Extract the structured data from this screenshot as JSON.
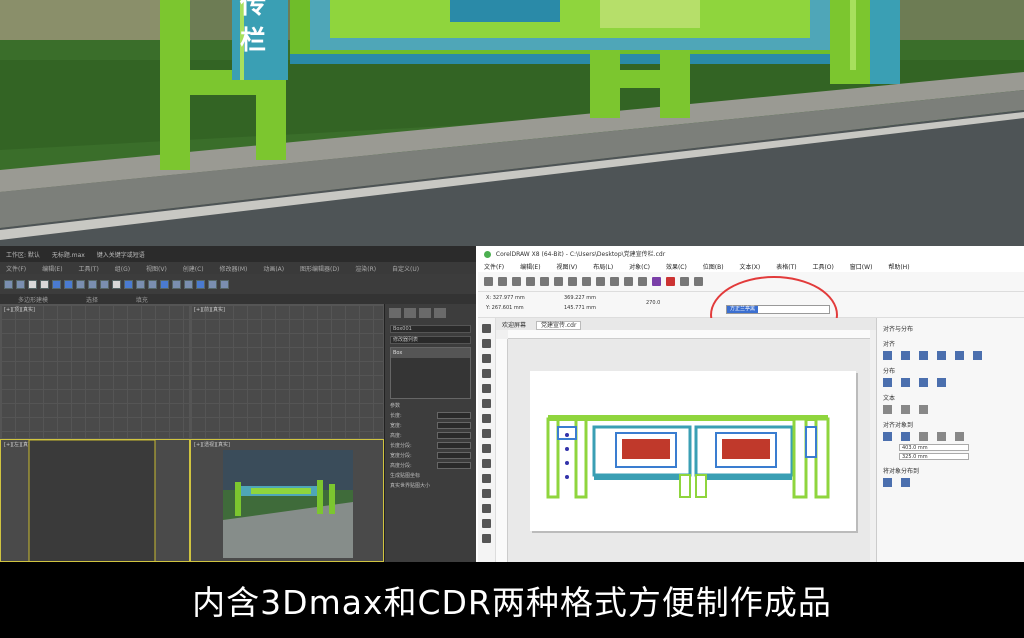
{
  "scene": {
    "left_sign_text": "栏",
    "left_sign_top_text": "传"
  },
  "max": {
    "title_items": [
      "工作区: 默认",
      "无标题.max",
      "键入关键字或短语"
    ],
    "menu_items": [
      "文件(F)",
      "编辑(E)",
      "工具(T)",
      "组(G)",
      "视图(V)",
      "创建(C)",
      "修改器(M)",
      "动画(A)",
      "图形编辑器(D)",
      "渲染(R)",
      "自定义(U)",
      "脚本(S)",
      "帮助(H)"
    ],
    "ribbon_items": [
      "多边形建模",
      "选择",
      "填充"
    ],
    "viewports": {
      "top": "[+][顶][真实]",
      "front": "[+][前][真实]",
      "left": "[+][左][真实]",
      "persp": "[+][透视][真实]"
    },
    "cmd": {
      "object_name": "Box001",
      "modifier": "修改器列表",
      "stack_item": "Box",
      "rollout": "参数",
      "params": [
        "长度:",
        "宽度:",
        "高度:",
        "长度分段:",
        "宽度分段:",
        "高度分段:"
      ],
      "checks": [
        "生成贴图坐标",
        "真实世界贴图大小"
      ]
    }
  },
  "cdr": {
    "title": "CorelDRAW X8 (64-Bit) - C:\\Users\\Desktop\\党建宣传栏.cdr",
    "menu_items": [
      "文件(F)",
      "编辑(E)",
      "视图(V)",
      "布局(L)",
      "对象(C)",
      "效果(C)",
      "位图(B)",
      "文本(X)",
      "表格(T)",
      "工具(O)",
      "窗口(W)",
      "帮助(H)"
    ],
    "prop_x": "X: 327.977 mm",
    "prop_y": "Y: 267.601 mm",
    "prop_w": "369.227 mm",
    "prop_h": "145.771 mm",
    "angle": "270.0",
    "font_value": "方正兰亭黑",
    "tabs": [
      "欢迎屏幕",
      "党建宣传.cdr"
    ],
    "dock": {
      "align_title": "对齐与分布",
      "align": "对齐",
      "distribute": "分布",
      "text": "文本",
      "align_objects": "对齐对象到",
      "field1": "403.0 mm",
      "field2": "325.0 mm",
      "distribute_objects": "将对象分布到"
    }
  },
  "caption": {
    "text": "内含3Dmax和CDR两种格式方便制作成品"
  },
  "colors": {
    "sign_green": "#8fd53d",
    "sign_teal": "#2a9bb5",
    "highlight_red": "#e23b3b"
  }
}
